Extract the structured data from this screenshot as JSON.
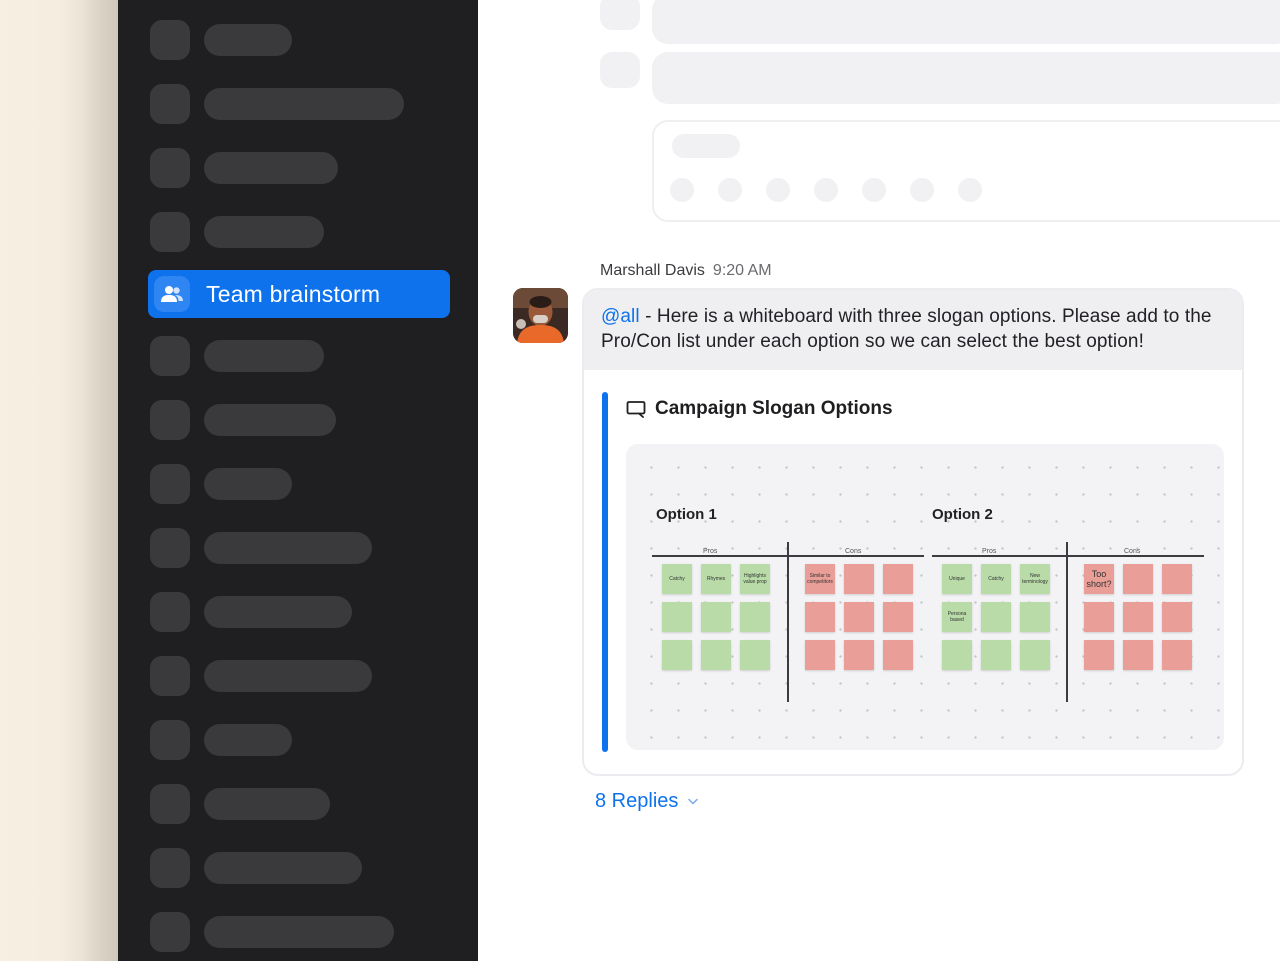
{
  "sidebar": {
    "active_channel": {
      "label": "Team brainstorm",
      "icon": "people-icon"
    },
    "accent_color": "#0e72ed"
  },
  "message": {
    "sender": "Marshall Davis",
    "time": "9:20 AM",
    "mention": "@all",
    "text": " - Here is a whiteboard with three slogan options. Please add to the Pro/Con list under each option so we can select the best option!",
    "attachment": {
      "icon": "whiteboard-icon",
      "title": "Campaign Slogan Options",
      "whiteboard": {
        "options": [
          {
            "title": "Option 1",
            "pros_label": "Pros",
            "cons_label": "Cons",
            "pros_notes": [
              "Catchy",
              "Rhymes",
              "Highlights value prop"
            ],
            "cons_notes": [
              "Similar to competitors"
            ]
          },
          {
            "title": "Option 2",
            "pros_label": "Pros",
            "cons_label": "Cons",
            "pros_notes": [
              "Unique",
              "Catchy",
              "New terminology",
              "Persona based"
            ],
            "cons_notes": [
              "Too short?"
            ]
          }
        ]
      }
    }
  },
  "replies": {
    "label": "8 Replies"
  }
}
